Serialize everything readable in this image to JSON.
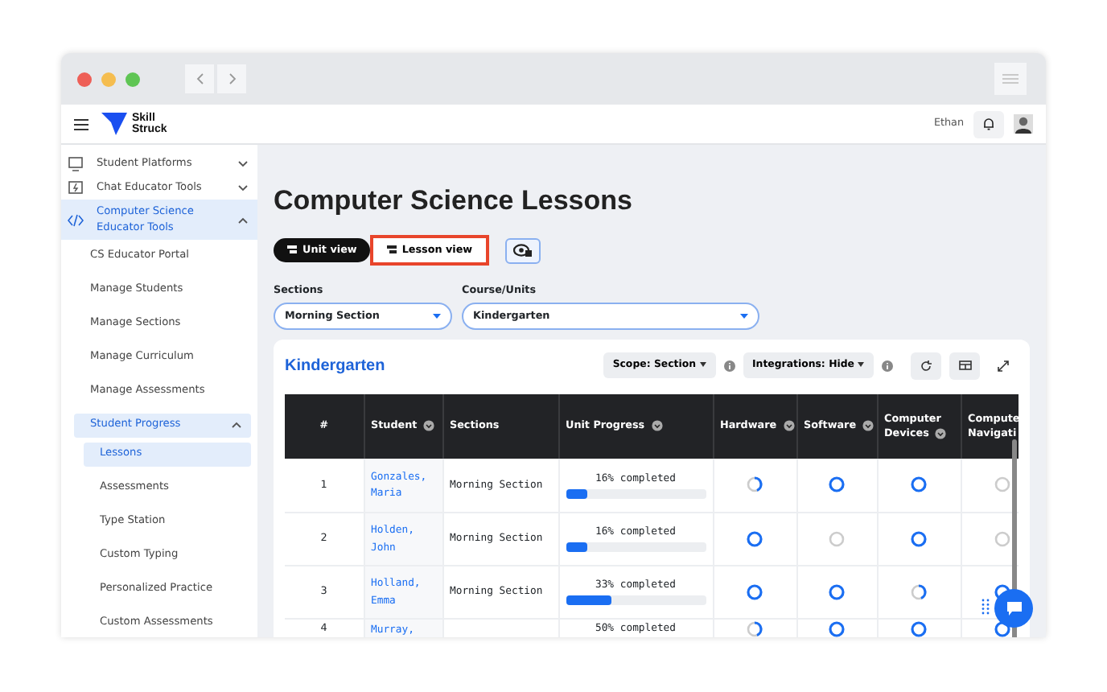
{
  "app": {
    "logo_text": "Skill Struck",
    "user_name": "Ethan"
  },
  "sidebar": {
    "items": [
      {
        "label": "Student Platforms",
        "expanded": false,
        "selected": false
      },
      {
        "label": "Chat Educator Tools",
        "expanded": false,
        "selected": false
      },
      {
        "label": "Computer Science Educator Tools",
        "expanded": true,
        "selected": true,
        "children": [
          {
            "label": "CS Educator Portal",
            "selected": false
          },
          {
            "label": "Manage Students",
            "selected": false
          },
          {
            "label": "Manage Sections",
            "selected": false
          },
          {
            "label": "Manage Curriculum",
            "selected": false
          },
          {
            "label": "Manage Assessments",
            "selected": false
          },
          {
            "label": "Student Progress",
            "expanded": true,
            "selected": true,
            "children": [
              {
                "label": "Lessons",
                "selected": true
              },
              {
                "label": "Assessments",
                "selected": false
              },
              {
                "label": "Type Station",
                "selected": false
              },
              {
                "label": "Custom Typing",
                "selected": false
              },
              {
                "label": "Personalized Practice",
                "selected": false
              },
              {
                "label": "Custom Assessments",
                "selected": false
              }
            ]
          }
        ]
      }
    ]
  },
  "page": {
    "title": "Computer Science Lessons",
    "view_toggle": [
      {
        "label": "Unit view",
        "selected": true,
        "highlighted": false
      },
      {
        "label": "Lesson view",
        "selected": false,
        "highlighted": true
      }
    ],
    "filters": [
      {
        "label": "Sections",
        "value": "Morning Section"
      },
      {
        "label": "Course/Units",
        "value": "Kindergarten"
      }
    ]
  },
  "card": {
    "title": "Kindergarten",
    "dropdowns": [
      {
        "label": "Scope: Section"
      },
      {
        "label": "Integrations: Hide"
      }
    ],
    "table": {
      "columns": [
        {
          "label": "#",
          "sortable": false
        },
        {
          "label": "Student",
          "sortable": true
        },
        {
          "label": "Sections",
          "sortable": false
        },
        {
          "label": "Unit Progress",
          "sortable": true
        },
        {
          "label": "Hardware",
          "sortable": true
        },
        {
          "label": "Software",
          "sortable": true
        },
        {
          "label": "Computer Devices",
          "sortable": true
        },
        {
          "label": "Compute Navigati",
          "sortable": false
        }
      ],
      "rows": [
        {
          "index": "1",
          "student": "Gonzales, Maria",
          "section": "Morning Section",
          "progress": "16% completed",
          "level": 0.16,
          "statuses": [
            {
              "kind": "partial"
            },
            {
              "kind": "complete"
            },
            {
              "kind": "complete"
            },
            {
              "kind": "none"
            }
          ]
        },
        {
          "index": "2",
          "student": "Holden, John",
          "section": "Morning Section",
          "progress": "16% completed",
          "level": 0.16,
          "statuses": [
            {
              "kind": "complete"
            },
            {
              "kind": "none"
            },
            {
              "kind": "complete"
            },
            {
              "kind": "none"
            }
          ]
        },
        {
          "index": "3",
          "student": "Holland, Emma",
          "section": "Morning Section",
          "progress": "33% completed",
          "level": 0.33,
          "statuses": [
            {
              "kind": "complete"
            },
            {
              "kind": "complete"
            },
            {
              "kind": "partial"
            },
            {
              "kind": "complete"
            }
          ]
        },
        {
          "index": "4",
          "student": "Murray,",
          "progress": "50% completed",
          "statuses": [
            {
              "kind": "partial"
            },
            {
              "kind": "complete"
            },
            {
              "kind": "complete"
            },
            {
              "kind": "complete"
            }
          ]
        }
      ]
    }
  }
}
